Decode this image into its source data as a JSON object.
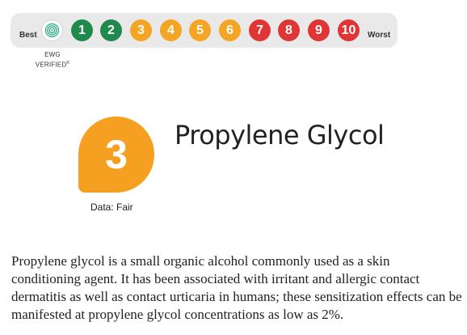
{
  "scale": {
    "best_label": "Best",
    "worst_label": "Worst",
    "verified_text": "EWG\nVERIFIED",
    "verified_mark": "®",
    "scores": [
      {
        "value": "1",
        "color": "#1f8a4c"
      },
      {
        "value": "2",
        "color": "#1f8a4c"
      },
      {
        "value": "3",
        "color": "#f5a524"
      },
      {
        "value": "4",
        "color": "#f5a524"
      },
      {
        "value": "5",
        "color": "#f5a524"
      },
      {
        "value": "6",
        "color": "#f5a524"
      },
      {
        "value": "7",
        "color": "#e03535"
      },
      {
        "value": "8",
        "color": "#e03535"
      },
      {
        "value": "9",
        "color": "#e03535"
      },
      {
        "value": "10",
        "color": "#e03535"
      }
    ],
    "verified_icon": "ewg-verified-icon"
  },
  "ingredient": {
    "score": "3",
    "score_color": "#f5a020",
    "data_label": "Data: Fair",
    "name": "Propylene Glycol",
    "description": "Propylene glycol is a small organic alcohol commonly used as a skin conditioning agent. It has been associated with irritant and allergic contact dermatitis as well as contact urticaria in humans; these sensitization effects can be manifested at propylene glycol concentrations as low as 2%."
  }
}
